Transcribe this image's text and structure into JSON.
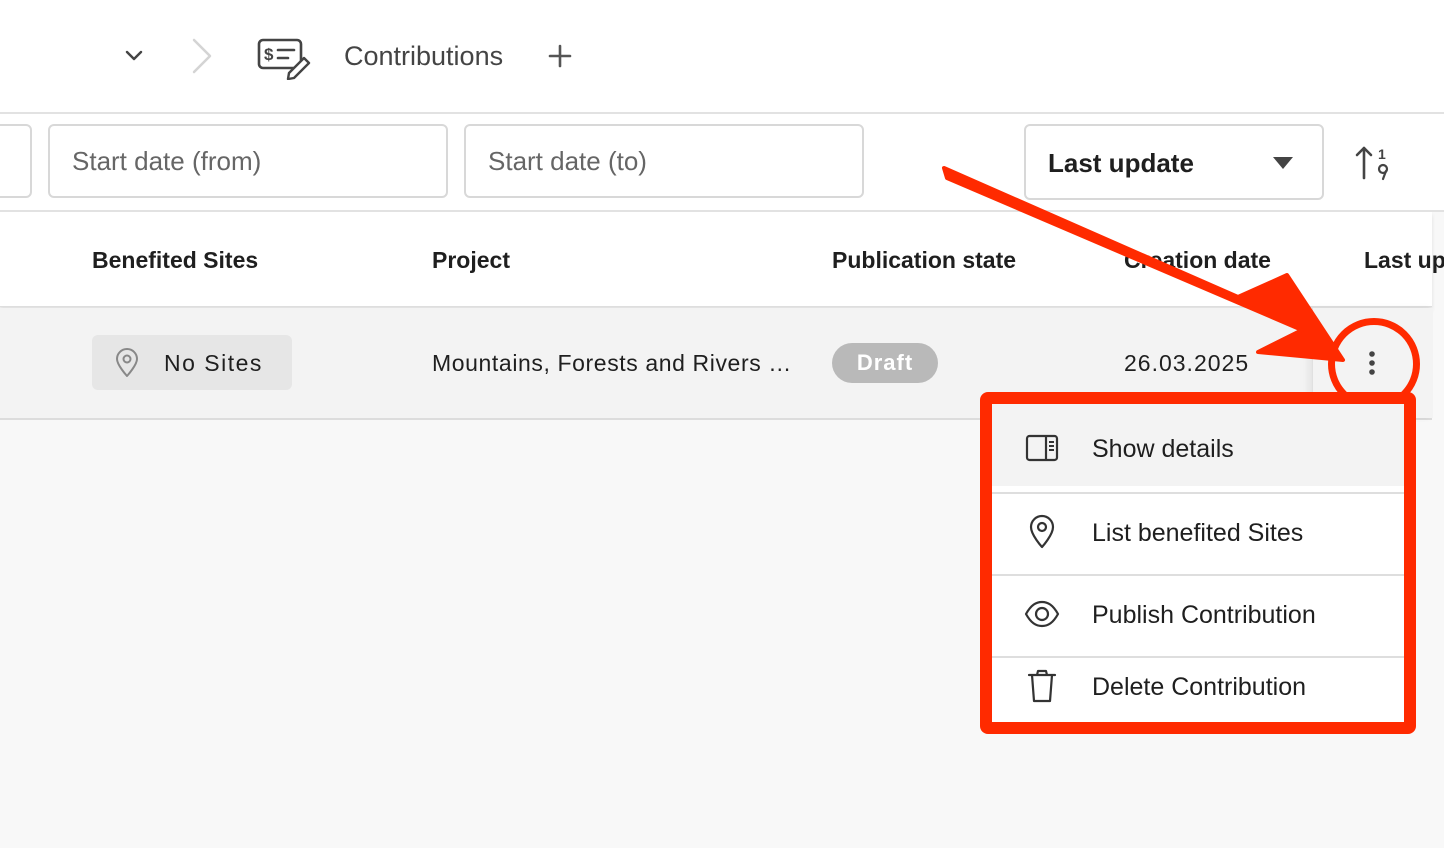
{
  "breadcrumb": {
    "collapse_icon": "chevron-down-icon",
    "separator_icon": "chevron-right-icon",
    "section_icon": "contribution-money-edit-icon",
    "title": "Contributions",
    "add_icon": "plus-icon"
  },
  "filters": {
    "start_from_placeholder": "Start date (from)",
    "start_to_placeholder": "Start date (to)",
    "sort_by": "Last update",
    "sort_caret_icon": "caret-down-icon",
    "sort_order_icon": "sort-ascending-numeric-icon"
  },
  "table": {
    "headers": {
      "sites": "Benefited Sites",
      "project": "Project",
      "state": "Publication state",
      "created": "Creation date",
      "updated": "Last update"
    },
    "rows": [
      {
        "sites": "No Sites",
        "sites_icon": "map-pin-icon",
        "project": "Mountains, Forests and Rivers Restoration",
        "state": "Draft",
        "created": "26.03.2025",
        "actions_icon": "kebab-menu-icon"
      }
    ]
  },
  "context_menu": {
    "items": [
      {
        "label": "Show details",
        "icon": "side-panel-icon"
      },
      {
        "label": "List benefited Sites",
        "icon": "map-pin-icon"
      },
      {
        "label": "Publish Contribution",
        "icon": "eye-icon"
      },
      {
        "label": "Delete Contribution",
        "icon": "trash-icon"
      }
    ]
  },
  "annotation": {
    "color": "#ff2a00"
  },
  "colors": {
    "draft_badge": "#b9b9b9",
    "row_background": "#f3f3f3"
  }
}
